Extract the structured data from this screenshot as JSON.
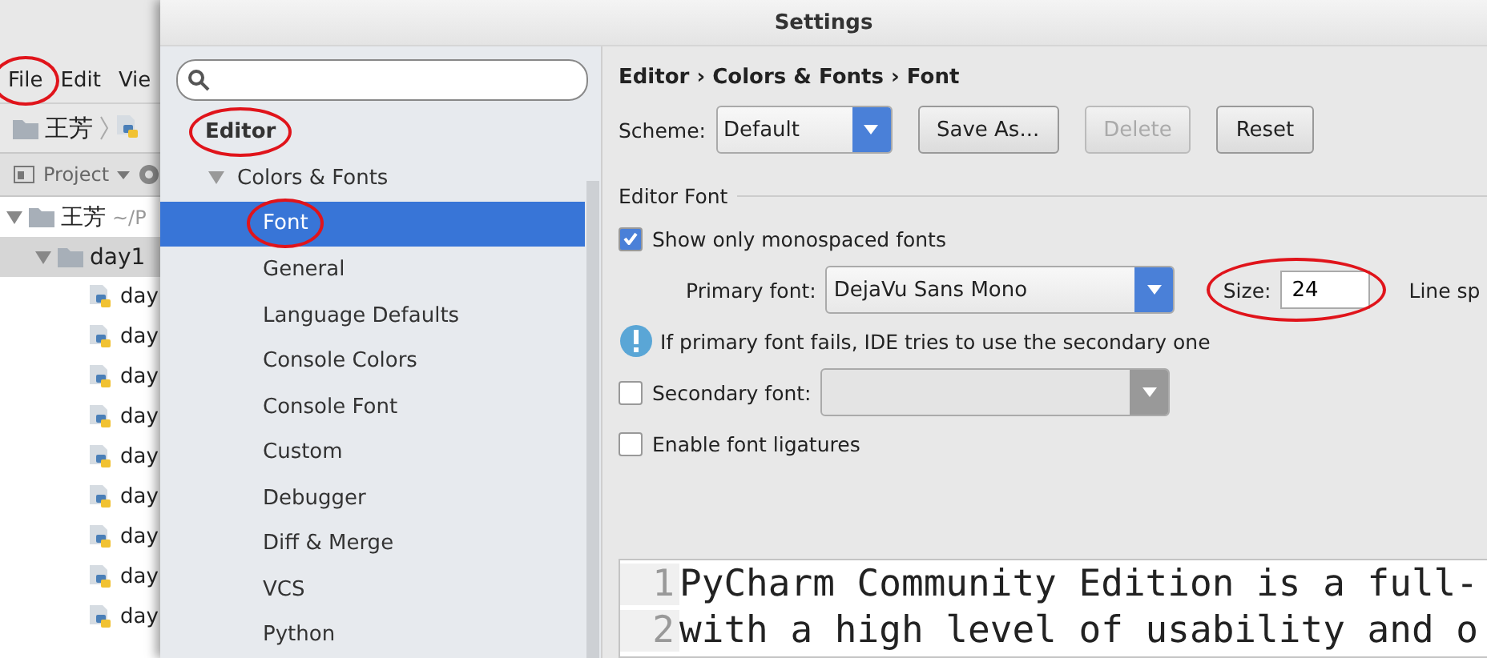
{
  "ide": {
    "menu": [
      {
        "label": "File",
        "circled": true
      },
      {
        "label": "Edit",
        "circled": false
      },
      {
        "label": "Vie",
        "circled": false
      }
    ],
    "breadcrumb": {
      "label": "王芳"
    },
    "tool_window": {
      "label": "Project"
    },
    "tree": [
      {
        "label": "王芳",
        "detail": "~/P",
        "selected": false,
        "expanded": true,
        "children": [
          {
            "label": "day1",
            "selected": true,
            "expanded": true,
            "children": [
              {
                "label": "day"
              },
              {
                "label": "day"
              },
              {
                "label": "day"
              },
              {
                "label": "day"
              },
              {
                "label": "day"
              },
              {
                "label": "day"
              },
              {
                "label": "day"
              },
              {
                "label": "day"
              },
              {
                "label": "day"
              }
            ]
          }
        ]
      }
    ]
  },
  "dialog": {
    "title": "Settings",
    "sidebar": {
      "items": [
        {
          "label": "Editor",
          "circled": true,
          "selected": false,
          "children": [
            {
              "label": "Colors & Fonts",
              "circled": false,
              "selected": false,
              "expanded": true,
              "children": [
                {
                  "label": "Font",
                  "circled": true,
                  "selected": true
                },
                {
                  "label": "General",
                  "circled": false,
                  "selected": false
                },
                {
                  "label": "Language Defaults",
                  "circled": false,
                  "selected": false
                },
                {
                  "label": "Console Colors",
                  "circled": false,
                  "selected": false
                },
                {
                  "label": "Console Font",
                  "circled": false,
                  "selected": false
                },
                {
                  "label": "Custom",
                  "circled": false,
                  "selected": false
                },
                {
                  "label": "Debugger",
                  "circled": false,
                  "selected": false
                },
                {
                  "label": "Diff & Merge",
                  "circled": false,
                  "selected": false
                },
                {
                  "label": "VCS",
                  "circled": false,
                  "selected": false
                },
                {
                  "label": "Python",
                  "circled": false,
                  "selected": false
                }
              ]
            }
          ]
        }
      ]
    },
    "breadcrumb": "Editor › Colors & Fonts › Font",
    "scheme": {
      "label": "Scheme:",
      "value": "Default"
    },
    "buttons": [
      {
        "label": "Save As...",
        "disabled": false
      },
      {
        "label": "Delete",
        "disabled": true
      },
      {
        "label": "Reset",
        "disabled": false
      }
    ],
    "section": "Editor Font",
    "monospaced": {
      "label": "Show only monospaced fonts",
      "checked": true
    },
    "primary_font": {
      "label": "Primary font:",
      "value": "DejaVu Sans Mono"
    },
    "size": {
      "label": "Size:",
      "value": "24",
      "circled": true
    },
    "line_spacing": {
      "label": "Line sp"
    },
    "info": "If primary font fails, IDE tries to use the secondary one",
    "secondary_font": {
      "label": "Secondary font:",
      "checked": false,
      "disabled": true
    },
    "ligatures": {
      "label": "Enable font ligatures",
      "checked": false
    },
    "preview": [
      {
        "number": "1",
        "text": "PyCharm Community Edition is a full-"
      },
      {
        "number": "2",
        "text": "with a high level of usability and o"
      }
    ]
  }
}
